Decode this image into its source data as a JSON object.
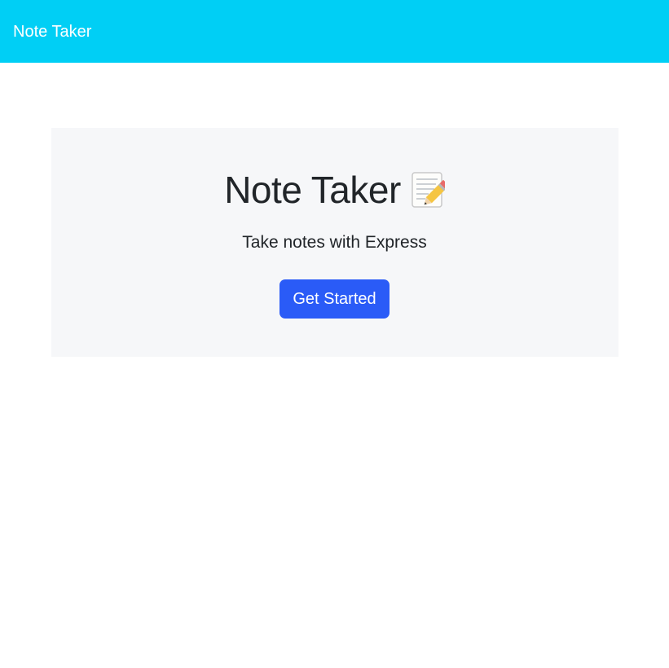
{
  "navbar": {
    "brand": "Note Taker",
    "background": "#00cff5"
  },
  "hero": {
    "title": "Note Taker",
    "title_icon": "memo-pencil-icon",
    "subtitle": "Take notes with Express",
    "cta_label": "Get Started",
    "cta_color": "#2a5bf7",
    "background": "#f6f7f9"
  }
}
